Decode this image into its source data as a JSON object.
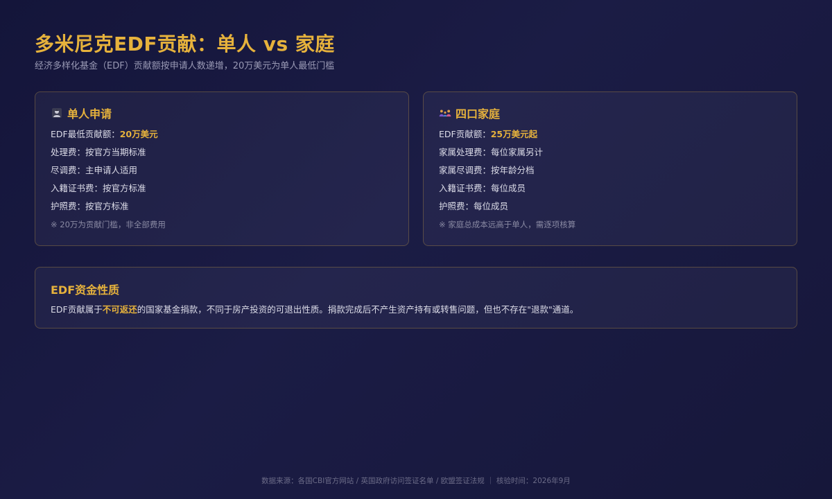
{
  "header": {
    "title": "多米尼克EDF贡献：单人 vs 家庭",
    "subtitle": "经济多样化基金（EDF）贡献额按申请人数递增，20万美元为单人最低门槛"
  },
  "single": {
    "icon": "person-icon",
    "heading": "单人申请",
    "rows": [
      {
        "label": "EDF最低贡献额：",
        "value": "20万美元"
      },
      {
        "label": "处理费：",
        "value": "按官方当期标准"
      },
      {
        "label": "尽调费：",
        "value": "主申请人适用"
      },
      {
        "label": "入籍证书费：",
        "value": "按官方标准"
      },
      {
        "label": "护照费：",
        "value": "按官方标准"
      }
    ],
    "note": "※ 20万为贡献门槛，非全部费用"
  },
  "family": {
    "icon": "family-icon",
    "heading": "四口家庭",
    "rows": [
      {
        "label": "EDF贡献额：",
        "value": "25万美元起"
      },
      {
        "label": "家属处理费：",
        "value": "每位家属另计"
      },
      {
        "label": "家属尽调费：",
        "value": "按年龄分档"
      },
      {
        "label": "入籍证书费：",
        "value": "每位成员"
      },
      {
        "label": "护照费：",
        "value": "每位成员"
      }
    ],
    "note": "※ 家庭总成本远高于单人，需逐项核算"
  },
  "edf": {
    "heading": "EDF资金性质",
    "text_before": "EDF贡献属于",
    "highlight": "不可返还",
    "text_after": "的国家基金捐款，不同于房产投资的可退出性质。捐款完成后不产生资产持有或转售问题，但也不存在\"退款\"通道。"
  },
  "footer": {
    "text": "数据来源：各国CBI官方网站 / 英国政府访问签证名单 / 欧盟签证法规 ｜ 核验时间：2026年9月"
  },
  "colors": {
    "accent": "#e6b23c",
    "background": "#16173a",
    "text": "#dcdce8",
    "muted": "#8a8aa3"
  }
}
